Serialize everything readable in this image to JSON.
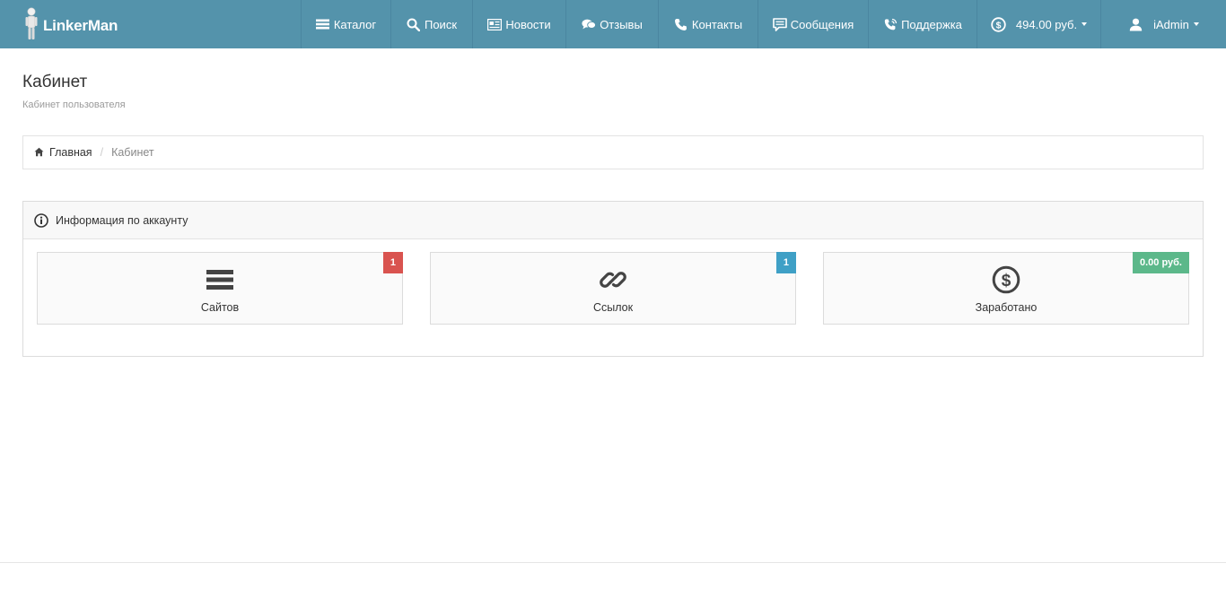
{
  "brand": {
    "name": "LinkerMan"
  },
  "nav": {
    "catalog": "Каталог",
    "search": "Поиск",
    "news": "Новости",
    "reviews": "Отзывы",
    "contacts": "Контакты",
    "messages": "Сообщения",
    "support": "Поддержка",
    "balance": "494.00 руб.",
    "user": "iAdmin"
  },
  "page": {
    "title": "Кабинет",
    "subtitle": "Кабинет пользователя"
  },
  "breadcrumb": {
    "home": "Главная",
    "current": "Кабинет"
  },
  "panel": {
    "title": "Информация по аккаунту",
    "tiles": [
      {
        "label": "Сайтов",
        "badge": "1",
        "icon": "list-icon"
      },
      {
        "label": "Ссылок",
        "badge": "1",
        "icon": "link-icon"
      },
      {
        "label": "Заработано",
        "badge": "0.00 руб.",
        "icon": "dollar-circle-icon"
      }
    ]
  },
  "colors": {
    "navbar": "#5493ab",
    "badge_red": "#d9534f",
    "badge_blue": "#3fa0c6",
    "badge_green": "#5cb88a"
  }
}
